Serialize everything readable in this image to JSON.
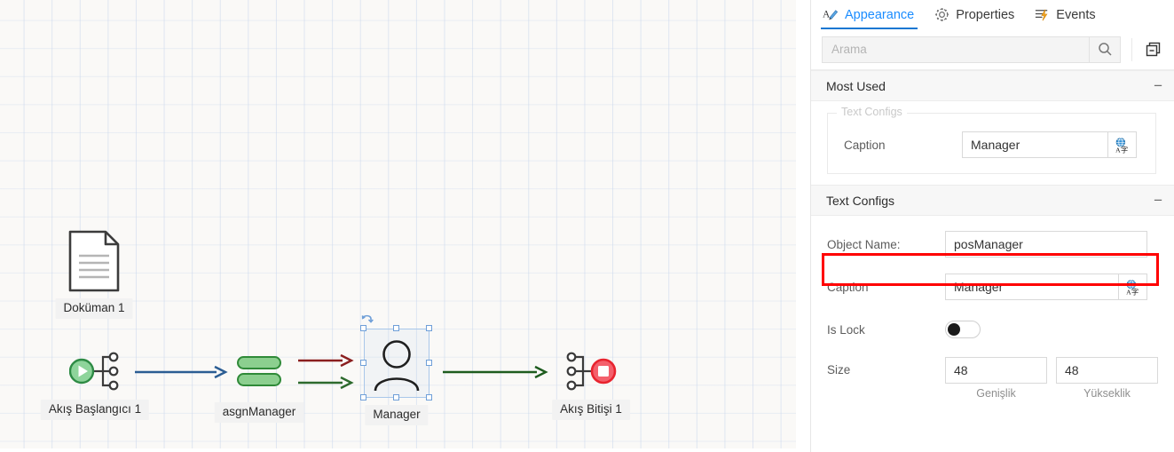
{
  "canvas": {
    "nodes": [
      {
        "id": "document",
        "label": "Doküman 1",
        "icon": "document-icon"
      },
      {
        "id": "start",
        "label": "Akış Başlangıcı 1",
        "icon": "flow-start-icon"
      },
      {
        "id": "assign",
        "label": "asgnManager",
        "icon": "assignment-icon"
      },
      {
        "id": "manager",
        "label": "Manager",
        "icon": "person-icon",
        "selected": true
      },
      {
        "id": "end",
        "label": "Akış Bitişi 1",
        "icon": "flow-end-icon"
      }
    ],
    "connectors": [
      {
        "id": "start-to-assign",
        "color": "#2b5d93"
      },
      {
        "id": "assign-to-manager-top",
        "color": "#8b1f1f"
      },
      {
        "id": "assign-to-manager-bottom",
        "color": "#2d6a2d"
      },
      {
        "id": "manager-to-end",
        "color": "#1e5c1e"
      }
    ],
    "colors": {
      "background": "#faf9f7",
      "grid": "#c8d6ec",
      "start_node": "#3fa34d",
      "end_node": "#ee2b3a",
      "assign_node": "#4caf50",
      "selection": "#6f9fd8"
    }
  },
  "panel": {
    "tabs": [
      {
        "id": "appearance",
        "label": "Appearance",
        "icon": "appearance-pen-icon",
        "active": true
      },
      {
        "id": "properties",
        "label": "Properties",
        "icon": "gear-icon",
        "active": false
      },
      {
        "id": "events",
        "label": "Events",
        "icon": "lightning-list-icon",
        "active": false
      }
    ],
    "search": {
      "placeholder": "Arama",
      "value": "",
      "icon": "search-icon"
    },
    "collapse_all_icon": "collapse-panels-icon",
    "sections": [
      {
        "id": "most-used",
        "title": "Most Used",
        "collapse_glyph": "−",
        "group": {
          "legend": "Text Configs",
          "rows": [
            {
              "id": "caption",
              "label": "Caption",
              "value": "Manager",
              "button_icon": "translate-icon"
            }
          ]
        }
      },
      {
        "id": "text-configs",
        "title": "Text Configs",
        "collapse_glyph": "−",
        "rows": [
          {
            "id": "object-name",
            "label": "Object Name:",
            "value": "posManager",
            "highlighted": true
          },
          {
            "id": "caption",
            "label": "Caption",
            "value": "Manager",
            "button_icon": "translate-icon"
          },
          {
            "id": "is-lock",
            "label": "Is Lock",
            "toggle": false
          },
          {
            "id": "size",
            "label": "Size",
            "width_value": "48",
            "height_value": "48",
            "width_sub": "Genişlik",
            "height_sub": "Yükseklik"
          }
        ]
      }
    ],
    "highlight_color": "#ff0000",
    "accent_color": "#1a8cff"
  }
}
